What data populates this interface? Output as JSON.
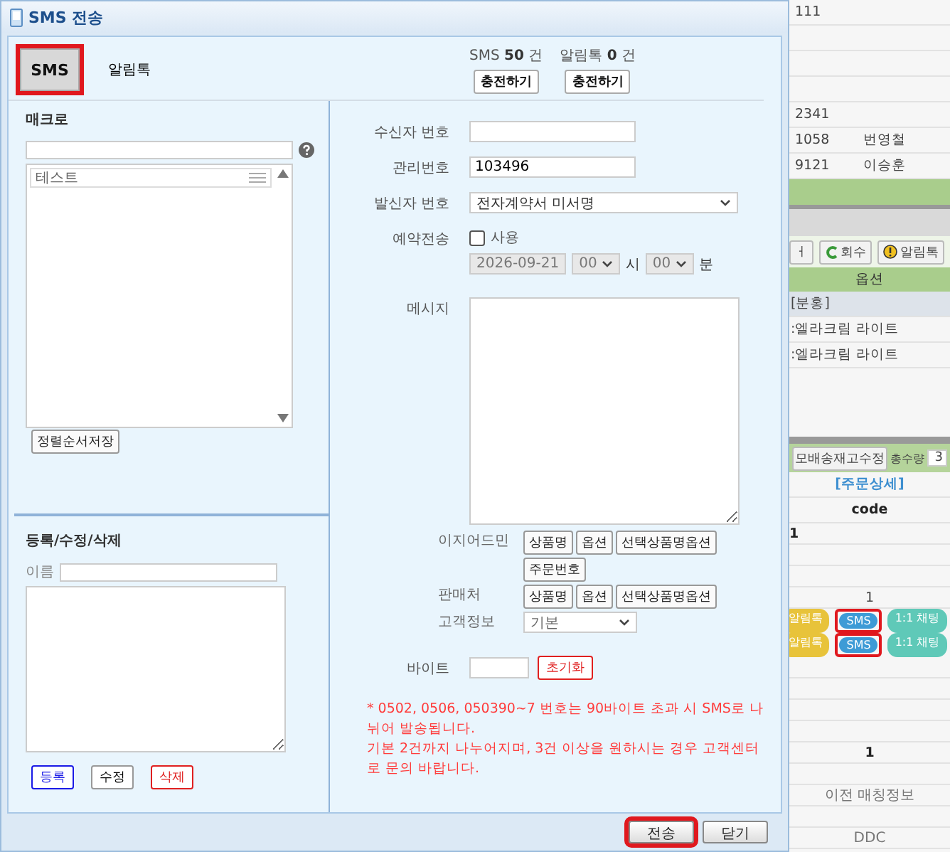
{
  "window": {
    "title": "SMS 전송"
  },
  "tabs": [
    {
      "label": "SMS",
      "selected": true,
      "highlighted": true
    },
    {
      "label": "알림톡",
      "selected": false,
      "highlighted": false
    }
  ],
  "balances": [
    {
      "label": "SMS",
      "count": "50",
      "unit": "건",
      "button": "충전하기"
    },
    {
      "label": "알림톡",
      "count": "0",
      "unit": "건",
      "button": "충전하기"
    }
  ],
  "macro": {
    "title": "매크로",
    "items": [
      {
        "label": "테스트"
      }
    ],
    "save_order_button": "정렬순서저장"
  },
  "editor": {
    "title": "등록/수정/삭제",
    "name_label": "이름",
    "buttons": [
      {
        "label": "등록",
        "kind": "primary"
      },
      {
        "label": "수정",
        "kind": "normal"
      },
      {
        "label": "삭제",
        "kind": "danger"
      }
    ]
  },
  "form": {
    "recipient_label": "수신자 번호",
    "manage_label": "관리번호",
    "manage_value": "103496",
    "sender_label": "발신자 번호",
    "sender_value": "전자계약서 미서명",
    "reserve_label": "예약전송",
    "reserve_use_label": "사용",
    "reserve_checked": false,
    "date": "2026-09-21",
    "hour": "00",
    "hour_unit": "시",
    "minute": "00",
    "minute_unit": "분",
    "message_label": "메시지",
    "insert_groups": [
      {
        "label": "이지어드민",
        "buttons": [
          "상품명",
          "옵션",
          "선택상품명옵션",
          "주문번호"
        ]
      },
      {
        "label": "판매처",
        "buttons": [
          "상품명",
          "옵션",
          "선택상품명옵션"
        ]
      }
    ],
    "customer_label": "고객정보",
    "customer_value": "기본",
    "bytes_label": "바이트",
    "reset_button": "초기화",
    "notice": "* 0502, 0506, 050390~7 번호는 90바이트 초과 시 SMS로 나뉘어 발송됩니다.\n기본 2건까지 나누어지며, 3건 이상을 원하시는 경우 고객센터로 문의 바랍니다."
  },
  "footer_buttons": [
    {
      "label": "전송",
      "highlighted": true
    },
    {
      "label": "닫기",
      "highlighted": false
    }
  ],
  "background": {
    "top_rows": [
      [
        "111",
        "",
        ""
      ],
      [
        "",
        "",
        ""
      ],
      [
        "",
        "",
        ""
      ],
      [
        "",
        "",
        ""
      ],
      [
        "2341",
        "",
        ""
      ],
      [
        "1058",
        "번영철",
        ""
      ],
      [
        "9121",
        "이승훈",
        ""
      ]
    ],
    "toolbar": [
      {
        "label": "ㅓ"
      },
      {
        "label": "회수"
      },
      {
        "label": "알림톡"
      }
    ],
    "option_header": "옵션",
    "option_rows": [
      {
        "text": "[분홍]",
        "kind": "group"
      },
      {
        "text": ":엘라크림 라이트",
        "kind": "item"
      },
      {
        "text": ":엘라크림 라이트",
        "kind": "item"
      }
    ],
    "stock_button": "모배송재고수정",
    "total_label": "총수량",
    "total_value": "3",
    "detail_link": "[주문상세]",
    "code_header": "code",
    "detail_rows": [
      {
        "text": "1",
        "kind": "left"
      },
      {
        "text": "",
        "kind": "center"
      },
      {
        "text": "",
        "kind": "center"
      },
      {
        "text": "1",
        "kind": "center"
      },
      {
        "kind": "badges",
        "badges": [
          {
            "label": "알림톡",
            "color": "#e8c33a",
            "highlighted": false
          },
          {
            "label": "SMS",
            "color": "#3d9bd6",
            "highlighted": true
          },
          {
            "label": "1:1 채팅",
            "color": "#5fc9b8",
            "highlighted": false
          }
        ]
      },
      {
        "kind": "badges",
        "badges": [
          {
            "label": "알림톡",
            "color": "#e8c33a",
            "highlighted": false
          },
          {
            "label": "SMS",
            "color": "#3d9bd6",
            "highlighted": true
          },
          {
            "label": "1:1 채팅",
            "color": "#5fc9b8",
            "highlighted": false
          }
        ]
      },
      {
        "text": "",
        "kind": "center"
      },
      {
        "text": "",
        "kind": "center"
      },
      {
        "text": "",
        "kind": "center"
      },
      {
        "text": "",
        "kind": "center"
      },
      {
        "text": "1",
        "kind": "bold"
      },
      {
        "text": "",
        "kind": "center"
      },
      {
        "text": "이전 매칭정보",
        "kind": "grey"
      },
      {
        "text": "",
        "kind": "center"
      },
      {
        "text": "DDC",
        "kind": "grey"
      }
    ]
  }
}
